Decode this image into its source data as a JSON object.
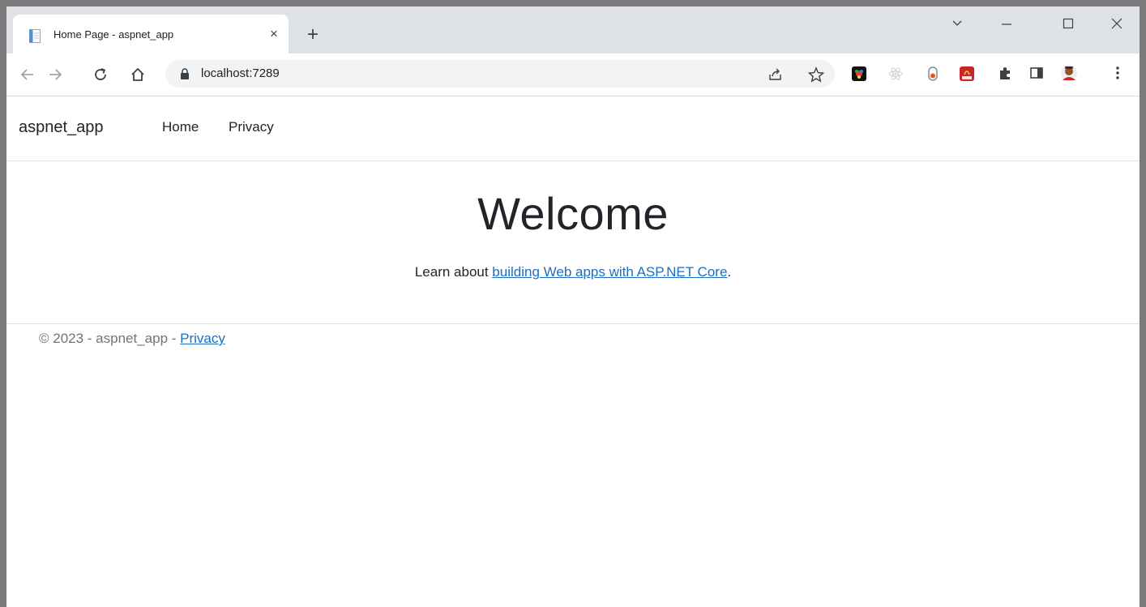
{
  "browser": {
    "tab": {
      "title": "Home Page - aspnet_app",
      "close_label": "×"
    },
    "new_tab_label": "+",
    "address": {
      "url": "localhost:7289"
    },
    "extensions": [
      "jolly-extension",
      "react-devtools",
      "toggle-extension",
      "pdf-extension",
      "puzzle-icon"
    ],
    "colors": {
      "tabstrip": "#dee1e6",
      "link": "#1b6ec2"
    }
  },
  "site": {
    "navbar": {
      "brand": "aspnet_app",
      "links": [
        {
          "label": "Home"
        },
        {
          "label": "Privacy"
        }
      ]
    },
    "main": {
      "heading": "Welcome",
      "intro_prefix": "Learn about ",
      "intro_link": "building Web apps with ASP.NET Core",
      "intro_suffix": "."
    },
    "footer": {
      "text": "© 2023 - aspnet_app - ",
      "link": "Privacy"
    }
  }
}
